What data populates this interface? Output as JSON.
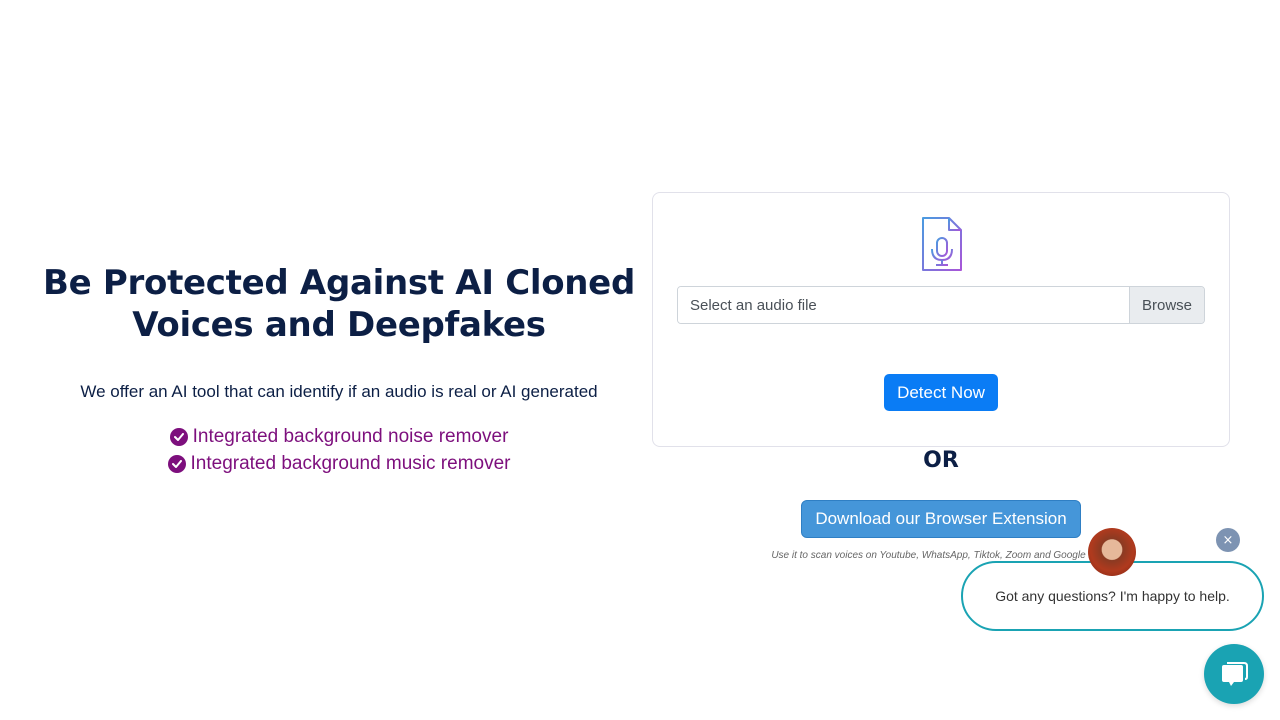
{
  "hero": {
    "title": "Be Protected Against AI Cloned Voices and Deepfakes",
    "subtitle": "We offer an AI tool that can identify if an audio is real or AI generated",
    "features": [
      {
        "icon": "check-circle-icon",
        "label": "Integrated background noise remover"
      },
      {
        "icon": "check-circle-icon",
        "label": "Integrated background music remover"
      }
    ]
  },
  "upload": {
    "icon": "audio-file-icon",
    "file_placeholder": "Select an audio file",
    "browse_label": "Browse",
    "detect_label": "Detect Now"
  },
  "alternative": {
    "or_label": "OR",
    "extension_button": "Download our Browser Extension",
    "extension_note": "Use it to scan voices on Youtube, WhatsApp, Tiktok, Zoom and Google Meet"
  },
  "chat": {
    "message": "Got any questions? I'm happy to help.",
    "close_icon": "×",
    "launcher_icon": "chat-bubbles-icon"
  },
  "colors": {
    "heading": "#0c1f45",
    "feature": "#7d0f7d",
    "primary": "#0a7cf5",
    "extension": "#4596d9",
    "chat": "#1aa3b3"
  }
}
